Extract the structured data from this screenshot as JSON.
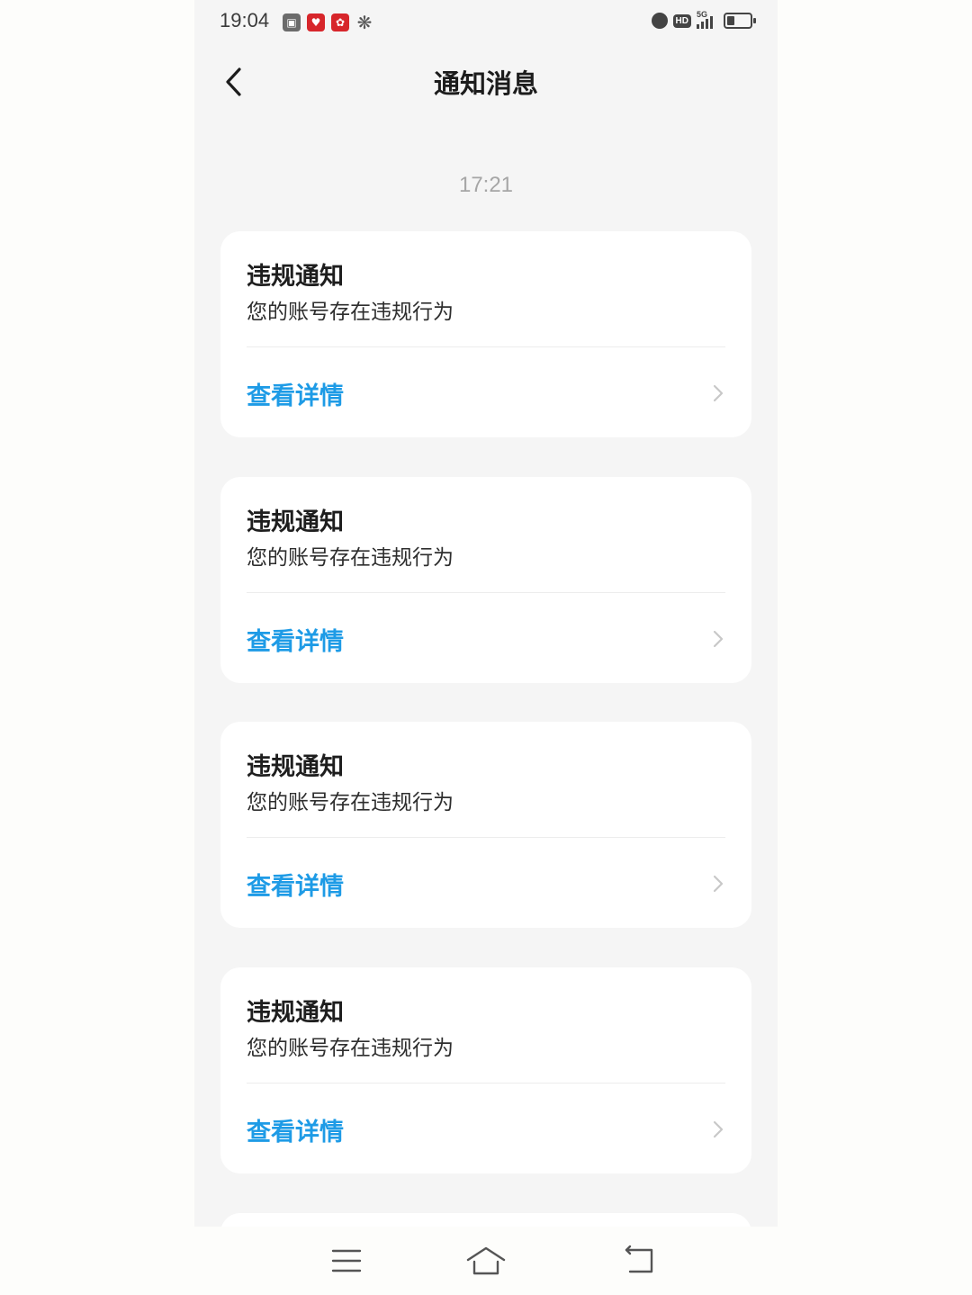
{
  "status_bar": {
    "time": "19:04",
    "battery_level": 0.35
  },
  "header": {
    "title": "通知消息"
  },
  "timestamp": "17:21",
  "notifications": [
    {
      "title": "违规通知",
      "body": "您的账号存在违规行为",
      "action": "查看详情"
    },
    {
      "title": "违规通知",
      "body": "您的账号存在违规行为",
      "action": "查看详情"
    },
    {
      "title": "违规通知",
      "body": "您的账号存在违规行为",
      "action": "查看详情"
    },
    {
      "title": "违规通知",
      "body": "您的账号存在违规行为",
      "action": "查看详情"
    }
  ],
  "colors": {
    "accent": "#1e9be6",
    "background": "#f5f5f5",
    "card": "#ffffff"
  },
  "icons": [
    "back-icon",
    "chevron-right-icon",
    "menu-icon",
    "home-icon",
    "back-nav-icon",
    "alarm-icon",
    "hd-icon",
    "signal-icon",
    "battery-icon"
  ]
}
